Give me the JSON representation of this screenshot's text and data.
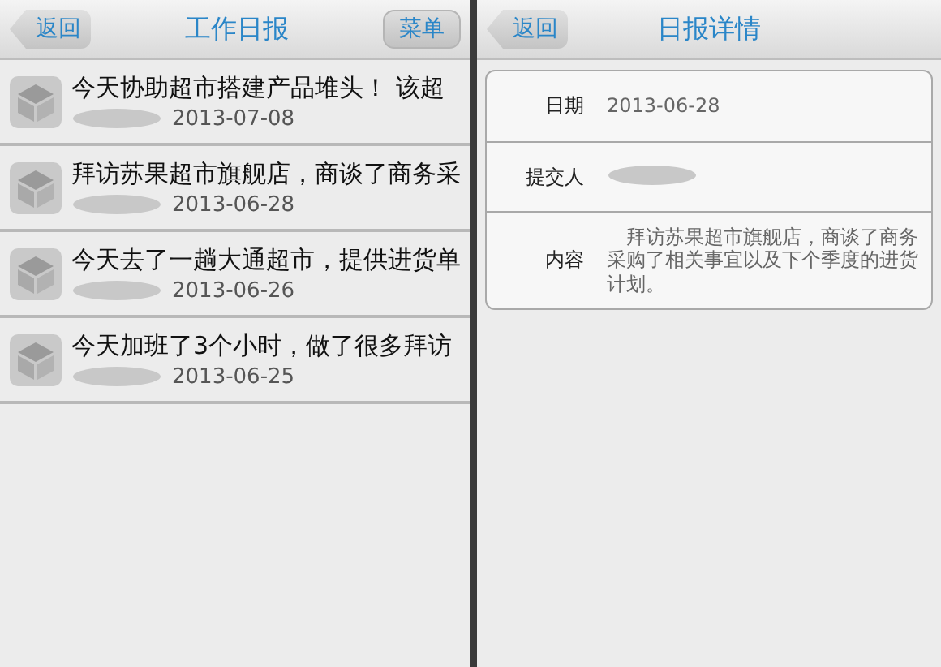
{
  "list_screen": {
    "back_button": "返回",
    "title": "工作日报",
    "menu_button": "菜单",
    "reports": [
      {
        "summary": "今天协助超市搭建产品堆头！ 该超",
        "date": "2013-07-08"
      },
      {
        "summary": "拜访苏果超市旗舰店，商谈了商务采",
        "date": "2013-06-28"
      },
      {
        "summary": "今天去了一趟大通超市，提供进货单",
        "date": "2013-06-26"
      },
      {
        "summary": "今天加班了3个小时，做了很多拜访",
        "date": "2013-06-25"
      }
    ]
  },
  "detail_screen": {
    "back_button": "返回",
    "title": "日报详情",
    "fields": [
      {
        "kind": "text",
        "label": "日期",
        "value": "2013-06-28"
      },
      {
        "kind": "redacted",
        "label": "提交人"
      },
      {
        "kind": "text",
        "label": "内容",
        "value": "　拜访苏果超市旗舰店，商谈了商务采购了相关事宜以及下个季度的进货计划。"
      }
    ]
  }
}
